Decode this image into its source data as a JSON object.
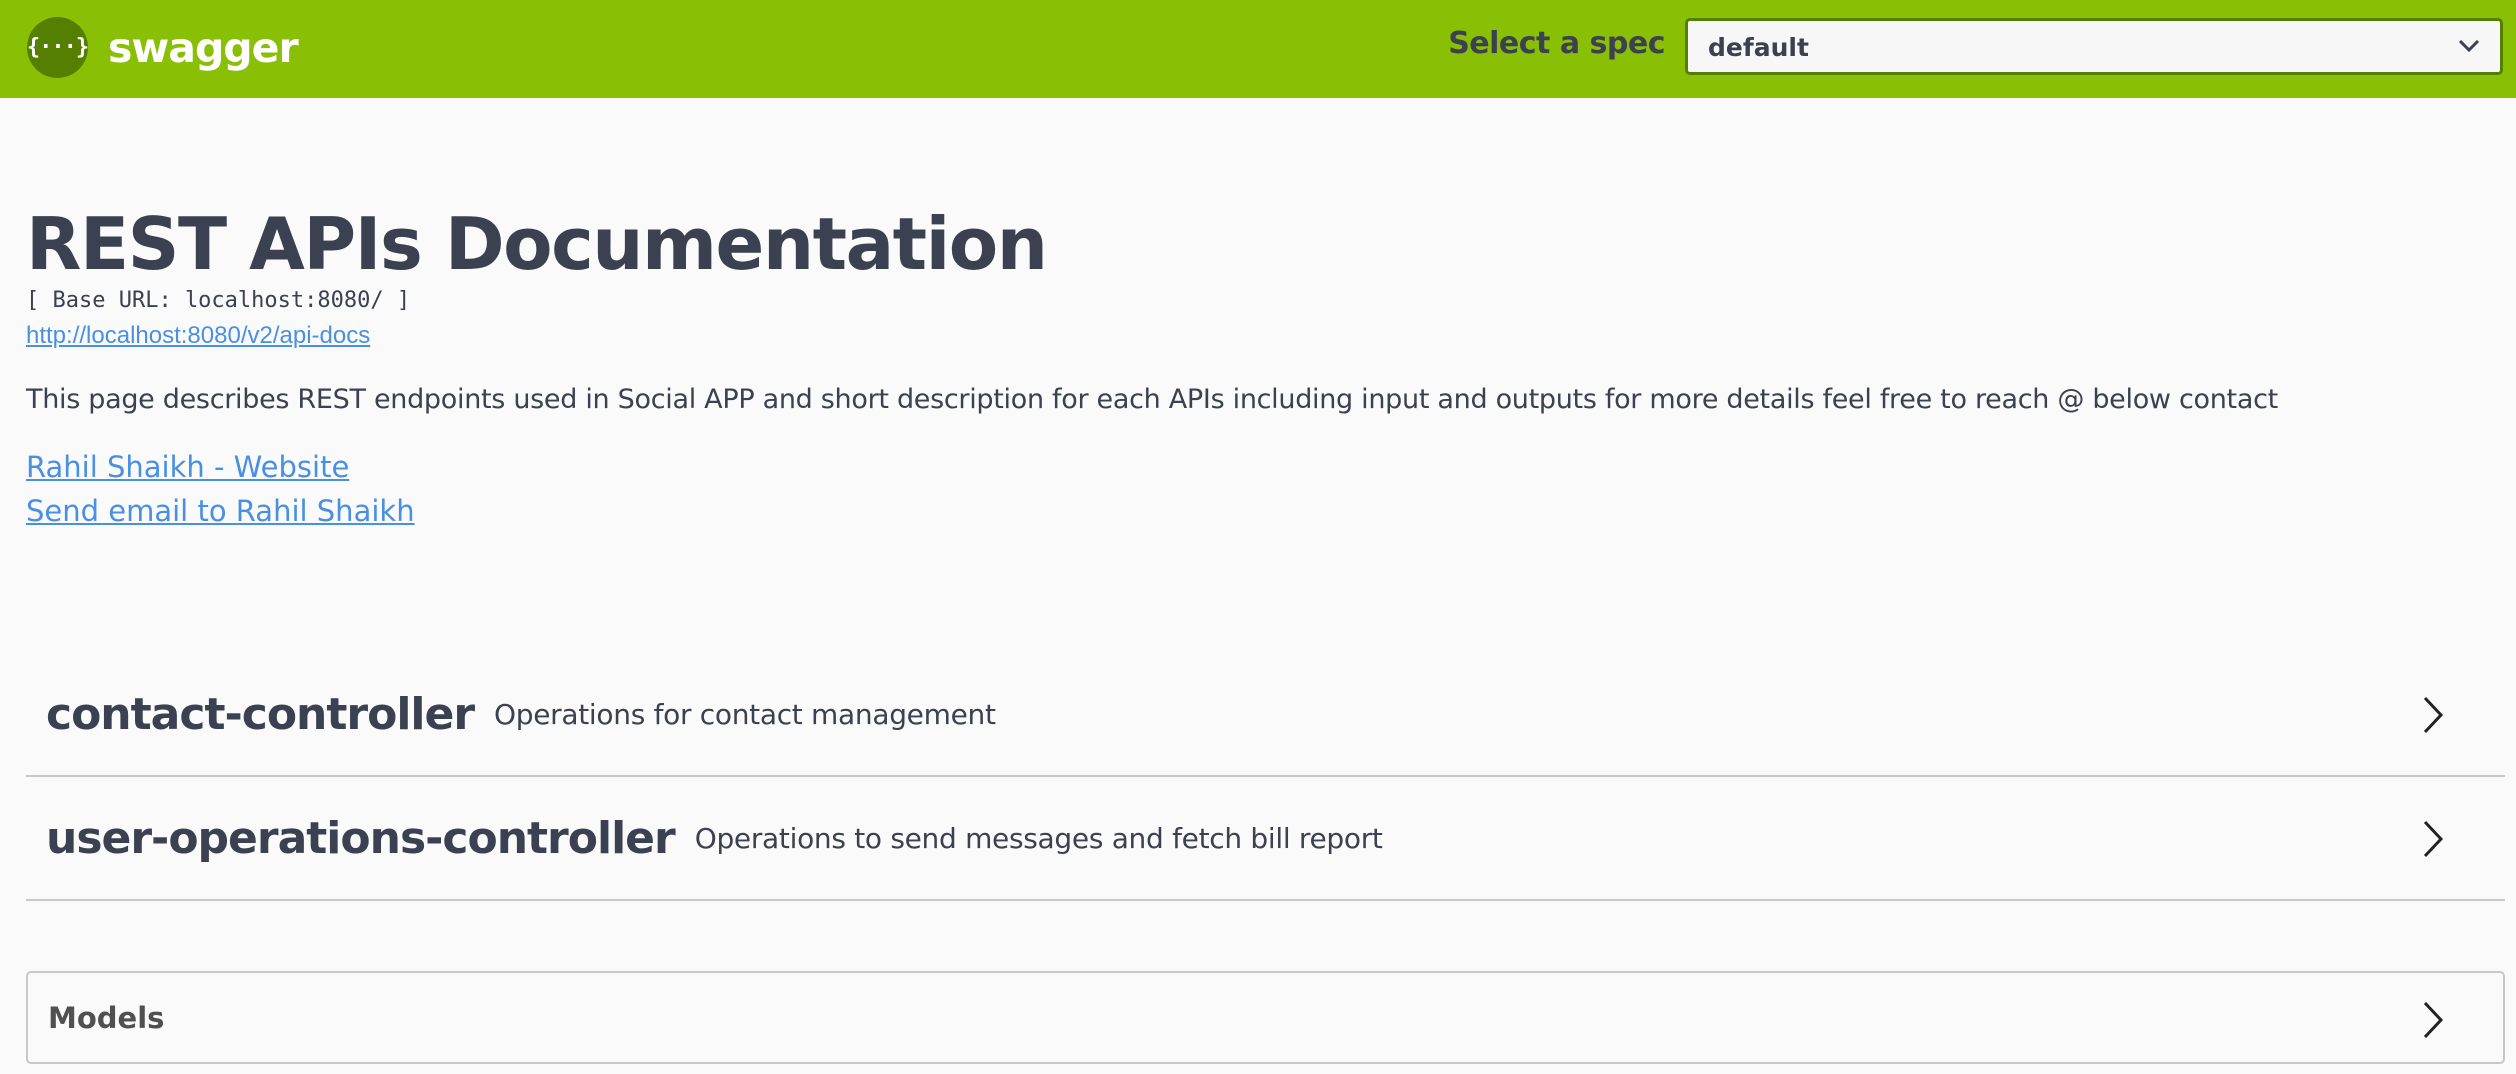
{
  "topbar": {
    "logo_glyph": "{···}",
    "logo_text": "swagger",
    "spec_label": "Select a spec",
    "spec_selected": "default",
    "brand_color": "#89bf04",
    "accent_dark": "#547f00"
  },
  "info": {
    "title": "REST APIs Documentation",
    "base_url": "[ Base URL: localhost:8080/ ]",
    "api_docs_link": "http://localhost:8080/v2/api-docs",
    "description": "This page describes REST endpoints used in Social APP and short description for each APIs including input and outputs for more details feel free to reach @ below contact",
    "contact_website": "Rahil Shaikh - Website",
    "contact_email": "Send email to Rahil Shaikh",
    "link_color": "#4990e2"
  },
  "tags": [
    {
      "name": "contact-controller",
      "description": "Operations for contact management"
    },
    {
      "name": "user-operations-controller",
      "description": "Operations to send messages and fetch bill report"
    }
  ],
  "models": {
    "title": "Models"
  },
  "icons": {
    "logo": "swagger-logo-icon",
    "select_chevron": "chevron-down-icon",
    "expand_chevron": "chevron-right-icon"
  }
}
